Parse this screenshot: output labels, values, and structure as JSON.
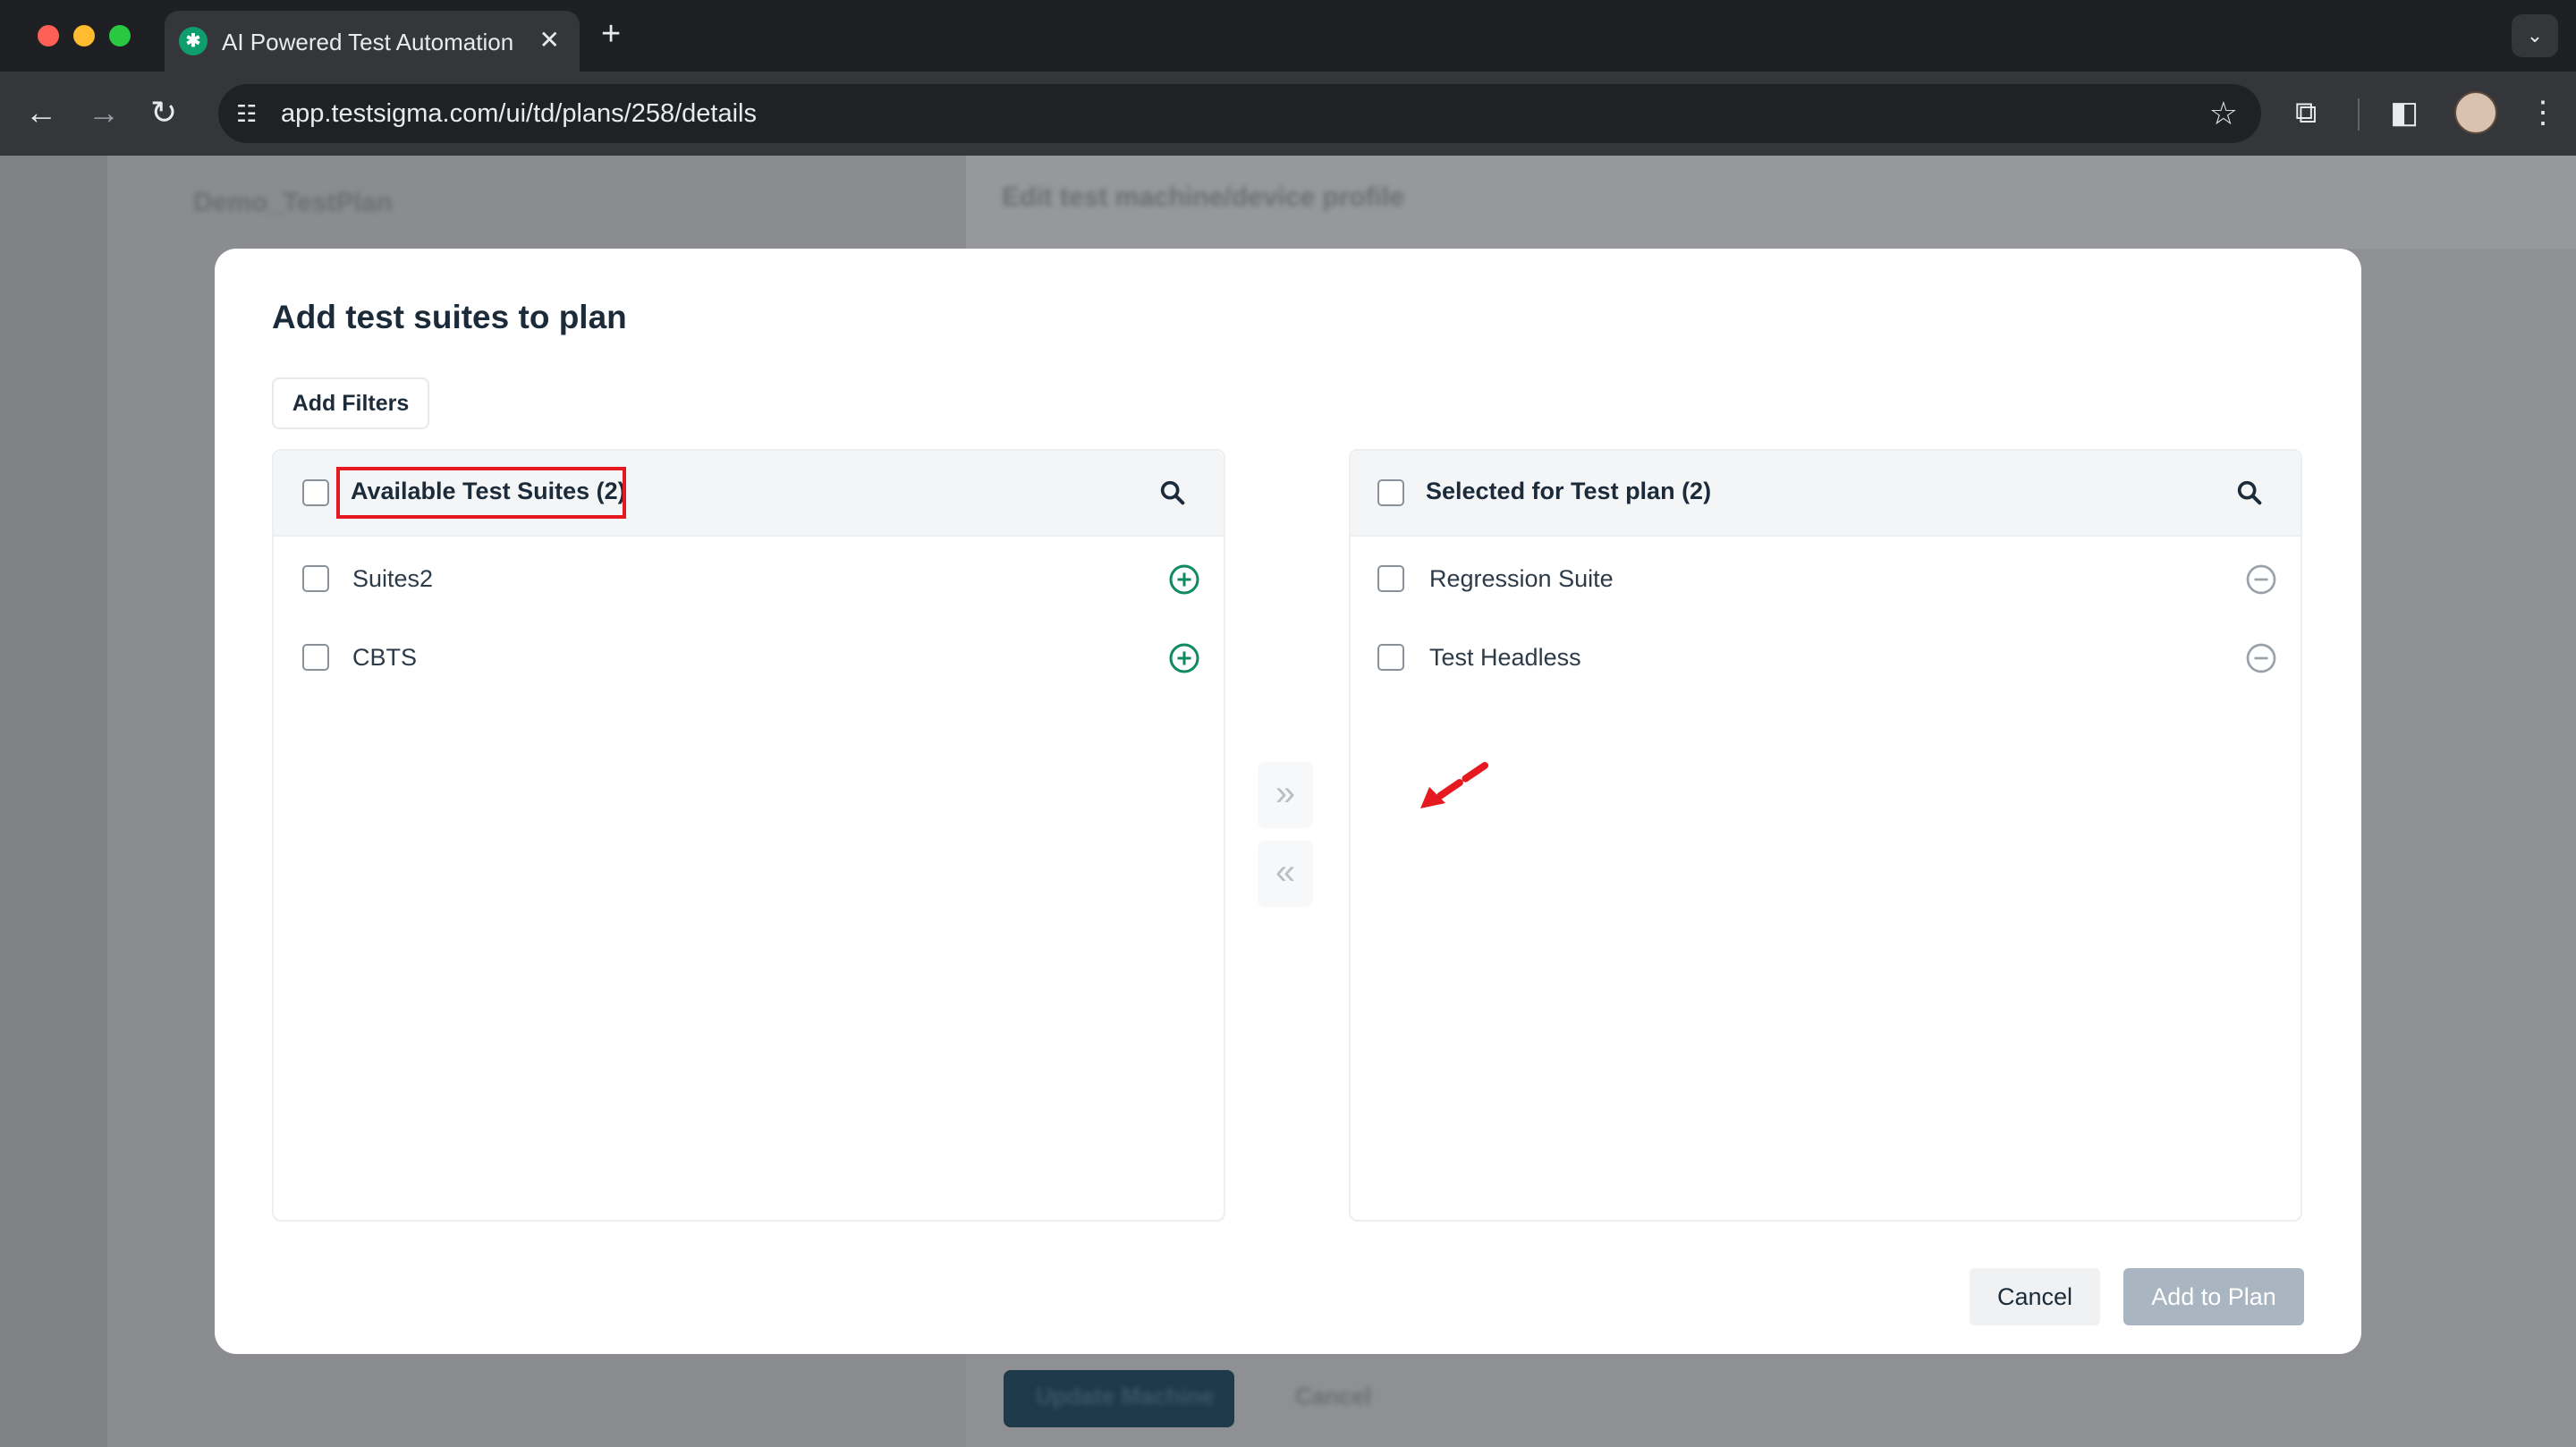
{
  "browser": {
    "tab_title": "AI Powered Test Automation",
    "tab_close": "✕",
    "new_tab": "+",
    "url": "app.testsigma.com/ui/td/plans/258/details"
  },
  "background_app": {
    "plan_name": "Demo_TestPlan",
    "side_panel_title": "Edit test machine/device profile",
    "primary_button": "Update Machine",
    "secondary_button": "Cancel"
  },
  "modal": {
    "title": "Add test suites to plan",
    "filter_button": "Add Filters",
    "available": {
      "header": "Available Test Suites (2)",
      "items": [
        {
          "label": "Suites2",
          "action_icon": "add-circle-icon"
        },
        {
          "label": "CBTS",
          "action_icon": "add-circle-icon"
        }
      ]
    },
    "selected": {
      "header": "Selected for Test plan (2)",
      "items": [
        {
          "label": "Regression Suite",
          "action_icon": "remove-circle-icon"
        },
        {
          "label": "Test Headless",
          "action_icon": "remove-circle-icon"
        }
      ]
    },
    "transfer_right": "»",
    "transfer_left": "«",
    "cancel_button": "Cancel",
    "submit_button": "Add to Plan"
  },
  "colors": {
    "accent_green": "#0f8a5f",
    "highlight_red": "#e5191f",
    "disabled_button": "#a9b5c0"
  }
}
